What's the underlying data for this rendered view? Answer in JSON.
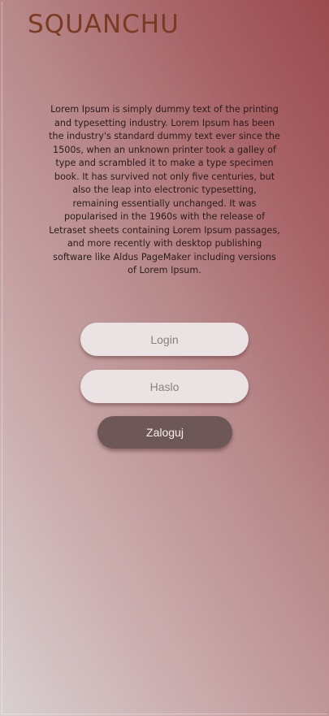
{
  "header": {
    "logo": "SQUANCHU"
  },
  "intro": {
    "text": "Lorem Ipsum is simply dummy text of the printing and typesetting industry. Lorem Ipsum has been the industry's standard dummy text ever since the 1500s, when an unknown printer took a galley of type and scrambled it to make a type specimen book. It has survived not only five centuries, but also the leap into electronic typesetting, remaining essentially unchanged. It was popularised in the 1960s with the release of Letraset sheets containing Lorem Ipsum passages, and more recently with desktop publishing software like Aldus PageMaker including versions of Lorem Ipsum."
  },
  "form": {
    "login_placeholder": "Login",
    "login_value": "",
    "password_placeholder": "Haslo",
    "password_value": "",
    "submit_label": "Zaloguj"
  },
  "colors": {
    "logo": "#7a3b22",
    "field_bg": "#ebe2e3",
    "button_bg": "#6e5757",
    "gradient_light": "#d9d0d1",
    "gradient_dark": "#9a4a4f"
  }
}
